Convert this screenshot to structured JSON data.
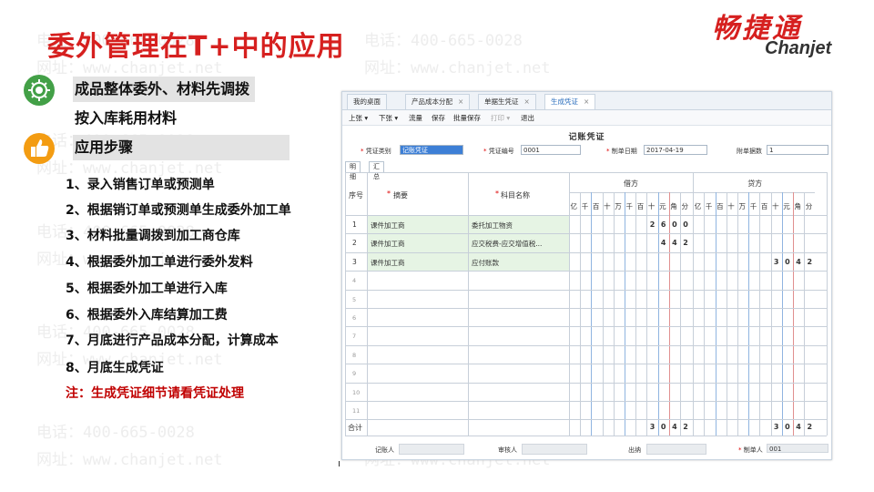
{
  "title": "委外管理在T+中的应用",
  "logo": {
    "cn": "畅捷通",
    "en": "Chanjet"
  },
  "watermark": {
    "phone": "电话：400-665-0028",
    "site": "网址：www.chanjet.net"
  },
  "bullets": [
    "成品整体委外、材料先调拨",
    "按入库耗用材料",
    "应用步骤"
  ],
  "steps": [
    "1、录入销售订单或预测单",
    "2、根据销订单或预测单生成委外加工单",
    "3、材料批量调拨到加工商仓库",
    "4、根据委外加工单进行委外发料",
    "5、根据委外加工单进行入库",
    "6、根据委外入库结算加工费",
    "7、月底进行产品成本分配，计算成本",
    "8、月底生成凭证"
  ],
  "note": "注：生成凭证细节请看凭证处理",
  "app": {
    "tabs": [
      {
        "label": "我的桌面",
        "closable": false
      },
      {
        "label": "产品成本分配",
        "closable": true
      },
      {
        "label": "单据生凭证",
        "closable": true
      },
      {
        "label": "生成凭证",
        "closable": true
      }
    ],
    "close_glyph": "×",
    "toolbar": [
      "上张 ▾",
      "下张 ▾",
      "流量",
      "保存",
      "批量保存",
      "打印 ▾",
      "退出"
    ],
    "voucher_title": "记账凭证",
    "header": {
      "type_label": "凭证类别",
      "type_value": "记账凭证",
      "no_label": "凭证编号",
      "no_value": "0001",
      "date_label": "制单日期",
      "date_value": "2017-04-19",
      "attach_label": "附单据数",
      "attach_value": "1"
    },
    "subtabs": [
      "明细",
      "汇总"
    ],
    "columns": {
      "seq": "序号",
      "summary": "摘要",
      "account": "科目名称",
      "debit": "借方",
      "credit": "贷方",
      "req": "*"
    },
    "digit_units": [
      "亿",
      "千",
      "百",
      "十",
      "万",
      "千",
      "百",
      "十",
      "元",
      "角",
      "分"
    ],
    "rows": [
      {
        "no": "1",
        "summary": "课件加工商",
        "account": "委托加工物资",
        "debit": "2600",
        "credit": ""
      },
      {
        "no": "2",
        "summary": "课件加工商",
        "account": "应交税费-应交增值税...",
        "debit": "442",
        "credit": ""
      },
      {
        "no": "3",
        "summary": "课件加工商",
        "account": "应付账款",
        "debit": "",
        "credit": "3042"
      }
    ],
    "empty_rows": [
      "4",
      "5",
      "6",
      "7",
      "8",
      "9",
      "10",
      "11"
    ],
    "total_label": "合计",
    "total_debit": "3042",
    "total_credit": "3042",
    "footer": {
      "bookkeeper": "记账人",
      "auditor": "审核人",
      "cashier": "出纳",
      "maker_label": "制单人",
      "maker_value": "001"
    }
  },
  "colors": {
    "accent": "#d6201f",
    "green": "#43a047",
    "orange": "#f39c12"
  }
}
